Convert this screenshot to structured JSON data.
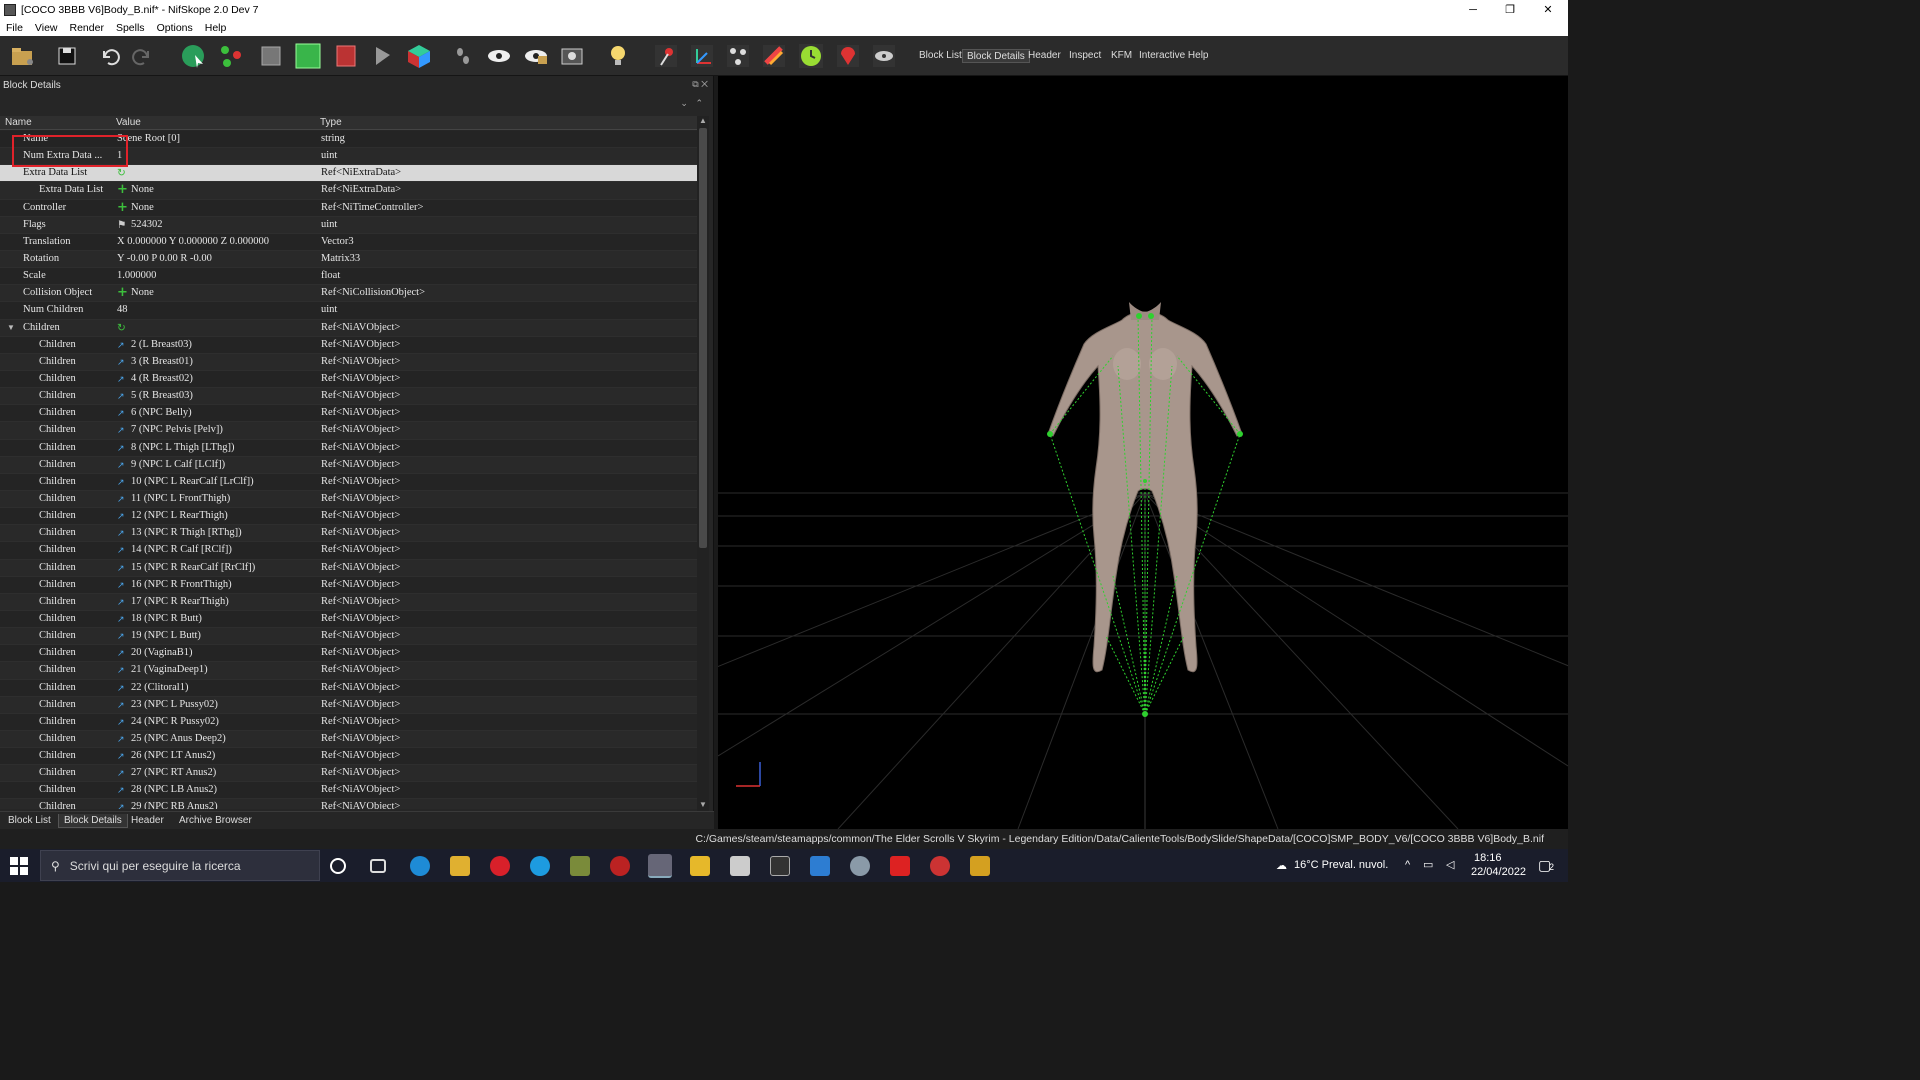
{
  "window": {
    "title": "[COCO 3BBB V6]Body_B.nif* - NifSkope 2.0 Dev 7",
    "minimize": "─",
    "restore": "❐",
    "close": "✕"
  },
  "menu": [
    "File",
    "View",
    "Render",
    "Spells",
    "Options",
    "Help"
  ],
  "toolbar": {
    "tabs": [
      "Block List",
      "Block Details",
      "Header",
      "Inspect",
      "KFM",
      "Interactive Help"
    ],
    "active_tab": "Block Details"
  },
  "panel": {
    "title": "Block Details",
    "columns": {
      "name": "Name",
      "value": "Value",
      "type": "Type"
    },
    "rows": [
      {
        "indent": 1,
        "name": "Name",
        "icon": "",
        "value": "Scene Root [0]",
        "type": "string"
      },
      {
        "indent": 1,
        "name": "Num Extra Data ...",
        "icon": "",
        "value": "1",
        "type": "uint"
      },
      {
        "indent": 1,
        "name": "Extra Data List",
        "icon": "refresh",
        "value": "",
        "type": "Ref<NiExtraData>",
        "selected": true
      },
      {
        "indent": 2,
        "name": "Extra Data List",
        "icon": "plus",
        "value": "None",
        "type": "Ref<NiExtraData>"
      },
      {
        "indent": 1,
        "name": "Controller",
        "icon": "plus",
        "value": "None",
        "type": "Ref<NiTimeController>"
      },
      {
        "indent": 1,
        "name": "Flags",
        "icon": "flag",
        "value": "524302",
        "type": "uint"
      },
      {
        "indent": 1,
        "name": "Translation",
        "icon": "",
        "value": "X 0.000000 Y 0.000000 Z 0.000000",
        "type": "Vector3"
      },
      {
        "indent": 1,
        "name": "Rotation",
        "icon": "",
        "value": "Y -0.00 P 0.00 R -0.00",
        "type": "Matrix33"
      },
      {
        "indent": 1,
        "name": "Scale",
        "icon": "",
        "value": "1.000000",
        "type": "float"
      },
      {
        "indent": 1,
        "name": "Collision Object",
        "icon": "plus",
        "value": "None",
        "type": "Ref<NiCollisionObject>"
      },
      {
        "indent": 1,
        "name": "Num Children",
        "icon": "",
        "value": "48",
        "type": "uint"
      },
      {
        "indent": 1,
        "name": "Children",
        "icon": "refresh",
        "value": "",
        "type": "Ref<NiAVObject>",
        "expanded": true
      },
      {
        "indent": 2,
        "name": "Children",
        "icon": "link",
        "value": "2 (L Breast03)",
        "type": "Ref<NiAVObject>"
      },
      {
        "indent": 2,
        "name": "Children",
        "icon": "link",
        "value": "3 (R Breast01)",
        "type": "Ref<NiAVObject>"
      },
      {
        "indent": 2,
        "name": "Children",
        "icon": "link",
        "value": "4 (R Breast02)",
        "type": "Ref<NiAVObject>"
      },
      {
        "indent": 2,
        "name": "Children",
        "icon": "link",
        "value": "5 (R Breast03)",
        "type": "Ref<NiAVObject>"
      },
      {
        "indent": 2,
        "name": "Children",
        "icon": "link",
        "value": "6 (NPC Belly)",
        "type": "Ref<NiAVObject>"
      },
      {
        "indent": 2,
        "name": "Children",
        "icon": "link",
        "value": "7 (NPC Pelvis [Pelv])",
        "type": "Ref<NiAVObject>"
      },
      {
        "indent": 2,
        "name": "Children",
        "icon": "link",
        "value": "8 (NPC L Thigh [LThg])",
        "type": "Ref<NiAVObject>"
      },
      {
        "indent": 2,
        "name": "Children",
        "icon": "link",
        "value": "9 (NPC L Calf [LClf])",
        "type": "Ref<NiAVObject>"
      },
      {
        "indent": 2,
        "name": "Children",
        "icon": "link",
        "value": "10 (NPC L RearCalf [LrClf])",
        "type": "Ref<NiAVObject>"
      },
      {
        "indent": 2,
        "name": "Children",
        "icon": "link",
        "value": "11 (NPC L FrontThigh)",
        "type": "Ref<NiAVObject>"
      },
      {
        "indent": 2,
        "name": "Children",
        "icon": "link",
        "value": "12 (NPC L RearThigh)",
        "type": "Ref<NiAVObject>"
      },
      {
        "indent": 2,
        "name": "Children",
        "icon": "link",
        "value": "13 (NPC R Thigh [RThg])",
        "type": "Ref<NiAVObject>"
      },
      {
        "indent": 2,
        "name": "Children",
        "icon": "link",
        "value": "14 (NPC R Calf [RClf])",
        "type": "Ref<NiAVObject>"
      },
      {
        "indent": 2,
        "name": "Children",
        "icon": "link",
        "value": "15 (NPC R RearCalf [RrClf])",
        "type": "Ref<NiAVObject>"
      },
      {
        "indent": 2,
        "name": "Children",
        "icon": "link",
        "value": "16 (NPC R FrontThigh)",
        "type": "Ref<NiAVObject>"
      },
      {
        "indent": 2,
        "name": "Children",
        "icon": "link",
        "value": "17 (NPC R RearThigh)",
        "type": "Ref<NiAVObject>"
      },
      {
        "indent": 2,
        "name": "Children",
        "icon": "link",
        "value": "18 (NPC R Butt)",
        "type": "Ref<NiAVObject>"
      },
      {
        "indent": 2,
        "name": "Children",
        "icon": "link",
        "value": "19 (NPC L Butt)",
        "type": "Ref<NiAVObject>"
      },
      {
        "indent": 2,
        "name": "Children",
        "icon": "link",
        "value": "20 (VaginaB1)",
        "type": "Ref<NiAVObject>"
      },
      {
        "indent": 2,
        "name": "Children",
        "icon": "link",
        "value": "21 (VaginaDeep1)",
        "type": "Ref<NiAVObject>"
      },
      {
        "indent": 2,
        "name": "Children",
        "icon": "link",
        "value": "22 (Clitoral1)",
        "type": "Ref<NiAVObject>"
      },
      {
        "indent": 2,
        "name": "Children",
        "icon": "link",
        "value": "23 (NPC L Pussy02)",
        "type": "Ref<NiAVObject>"
      },
      {
        "indent": 2,
        "name": "Children",
        "icon": "link",
        "value": "24 (NPC R Pussy02)",
        "type": "Ref<NiAVObject>"
      },
      {
        "indent": 2,
        "name": "Children",
        "icon": "link",
        "value": "25 (NPC Anus Deep2)",
        "type": "Ref<NiAVObject>"
      },
      {
        "indent": 2,
        "name": "Children",
        "icon": "link",
        "value": "26 (NPC LT Anus2)",
        "type": "Ref<NiAVObject>"
      },
      {
        "indent": 2,
        "name": "Children",
        "icon": "link",
        "value": "27 (NPC RT Anus2)",
        "type": "Ref<NiAVObject>"
      },
      {
        "indent": 2,
        "name": "Children",
        "icon": "link",
        "value": "28 (NPC LB Anus2)",
        "type": "Ref<NiAVObject>"
      },
      {
        "indent": 2,
        "name": "Children",
        "icon": "link",
        "value": "29 (NPC RB Anus2)",
        "type": "Ref<NiAVObject>"
      }
    ],
    "bottom_tabs": [
      "Block List",
      "Block Details",
      "Header",
      "Archive Browser"
    ],
    "active_bottom_tab": "Block Details"
  },
  "status_path": "C:/Games/steam/steamapps/common/The Elder Scrolls V Skyrim - Legendary Edition/Data/CalienteTools/BodySlide/ShapeData/[COCO]SMP_BODY_V6/[COCO 3BBB V6]Body_B.nif",
  "taskbar": {
    "search_placeholder": "Scrivi qui per eseguire la ricerca",
    "weather": "16°C  Preval. nuvol.",
    "time": "18:16",
    "date": "22/04/2022",
    "notifications": "2"
  },
  "colors": {
    "accent_green": "#3cbf3c",
    "highlight_red": "#e0222a",
    "link_blue": "#4aa3e8"
  }
}
